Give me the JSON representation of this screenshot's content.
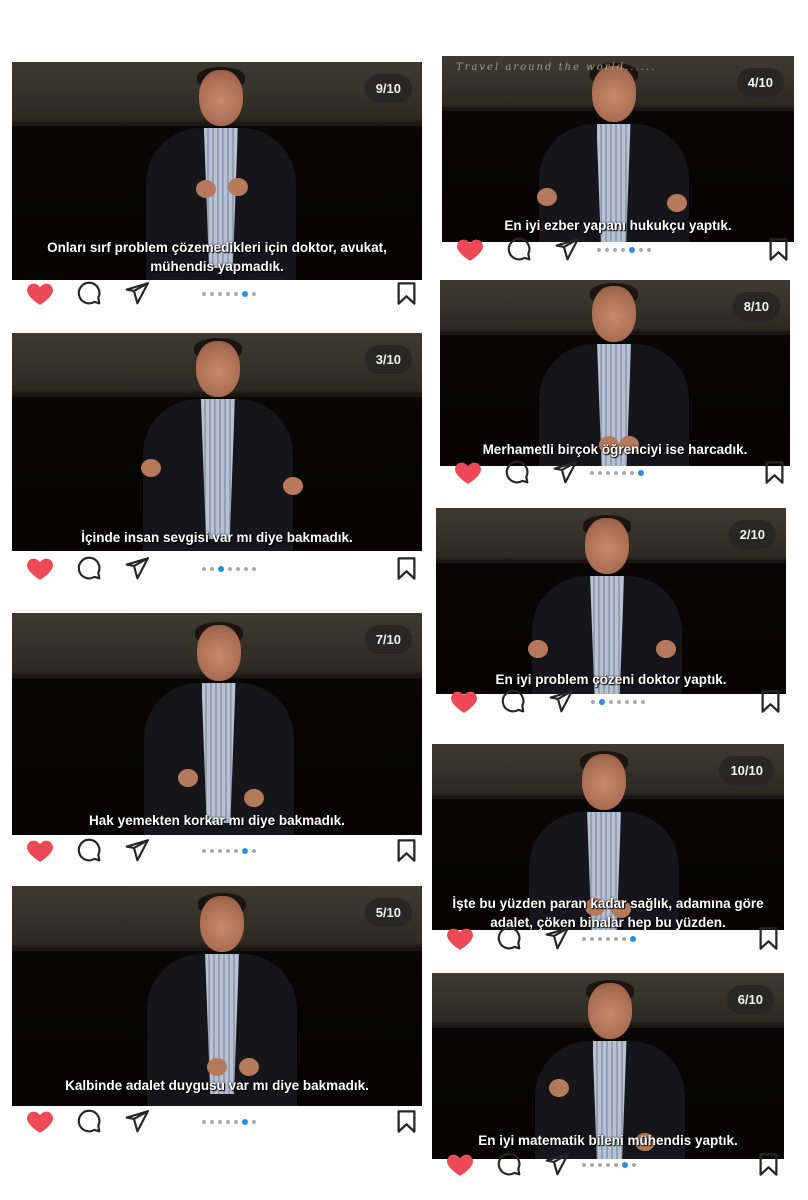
{
  "posts": [
    {
      "counter": "9/10",
      "caption": "Onları sırf problem çözemedikleri için doktor, avukat, mühendis yapmadık.",
      "dots_total": 7,
      "dot_active": 5
    },
    {
      "counter": "4/10",
      "watermark": "Travel around the world......",
      "caption": "En iyi ezber yapanı hukukçu yaptık.",
      "dots_total": 7,
      "dot_active": 4
    },
    {
      "counter": "8/10",
      "caption": "Merhametli birçok öğrenciyi ise harcadık.",
      "dots_total": 7,
      "dot_active": 6
    },
    {
      "counter": "3/10",
      "caption": "İçinde insan sevgisi var mı diye bakmadık.",
      "dots_total": 7,
      "dot_active": 2
    },
    {
      "counter": "2/10",
      "caption": "En iyi problem çözeni doktor yaptık.",
      "dots_total": 7,
      "dot_active": 1
    },
    {
      "counter": "7/10",
      "caption": "Hak yemekten korkar mı diye bakmadık.",
      "dots_total": 7,
      "dot_active": 5
    },
    {
      "counter": "10/10",
      "caption": "İşte bu yüzden paran kadar sağlık, adamına göre adalet, çöken binalar hep bu yüzden.",
      "dots_total": 7,
      "dot_active": 6
    },
    {
      "counter": "5/10",
      "caption": "Kalbinde adalet duygusu var mı diye bakmadık.",
      "dots_total": 7,
      "dot_active": 5
    },
    {
      "counter": "6/10",
      "caption": "En iyi matematik bileni mühendis yaptık.",
      "dots_total": 7,
      "dot_active": 5
    }
  ],
  "icons": {
    "like": "heart-icon",
    "comment": "comment-icon",
    "share": "send-icon",
    "save": "bookmark-icon"
  },
  "colors": {
    "like": "#ed4956",
    "dot_active": "#2a8ee0",
    "dot": "#a9a9a9",
    "icon": "#262626"
  }
}
